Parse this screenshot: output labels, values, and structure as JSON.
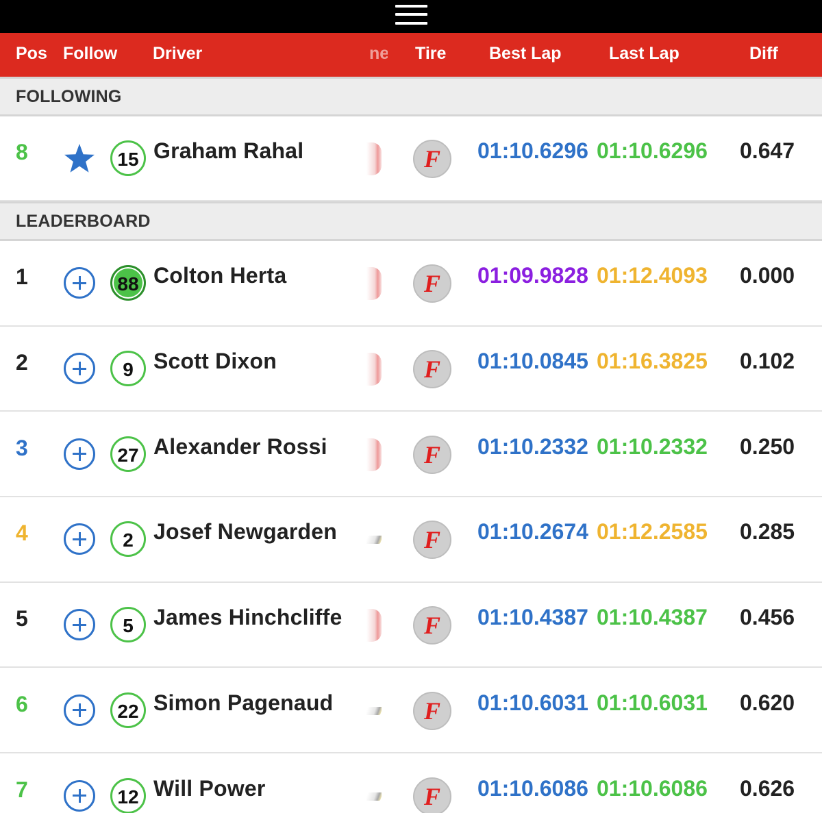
{
  "topbar": {
    "menu_icon": "hamburger-menu-icon"
  },
  "columns": {
    "pos": "Pos",
    "follow": "Follow",
    "driver": "Driver",
    "time_partial": "ne",
    "tire": "Tire",
    "best_lap": "Best Lap",
    "last_lap": "Last Lap",
    "diff": "Diff"
  },
  "sections": {
    "following": "FOLLOWING",
    "leaderboard": "LEADERBOARD"
  },
  "colors": {
    "header_red": "#dc2a1f",
    "link_blue": "#2f72c8",
    "green": "#4cc248",
    "yellow": "#efb430",
    "purple": "#8b1fe0",
    "black": "#222222"
  },
  "following": [
    {
      "pos": "8",
      "pos_color": "#4cc248",
      "follow": "star",
      "car": "15",
      "car_filled": false,
      "driver": "Graham Rahal",
      "time_icon": "red",
      "tire": "F",
      "best": "01:10.6296",
      "best_color": "#2f72c8",
      "last": "01:10.6296",
      "last_color": "#4cc248",
      "diff": "0.647"
    }
  ],
  "leaderboard": [
    {
      "pos": "1",
      "pos_color": "#222222",
      "follow": "plus",
      "car": "88",
      "car_filled": true,
      "driver": "Colton Herta",
      "time_icon": "red",
      "tire": "F",
      "best": "01:09.9828",
      "best_color": "#8b1fe0",
      "last": "01:12.4093",
      "last_color": "#efb430",
      "diff": "0.000"
    },
    {
      "pos": "2",
      "pos_color": "#222222",
      "follow": "plus",
      "car": "9",
      "car_filled": false,
      "driver": "Scott Dixon",
      "time_icon": "red",
      "tire": "F",
      "best": "01:10.0845",
      "best_color": "#2f72c8",
      "last": "01:16.3825",
      "last_color": "#efb430",
      "diff": "0.102"
    },
    {
      "pos": "3",
      "pos_color": "#2f72c8",
      "follow": "plus",
      "car": "27",
      "car_filled": false,
      "driver": "Alexander Rossi",
      "time_icon": "red",
      "tire": "F",
      "best": "01:10.2332",
      "best_color": "#2f72c8",
      "last": "01:10.2332",
      "last_color": "#4cc248",
      "diff": "0.250"
    },
    {
      "pos": "4",
      "pos_color": "#efb430",
      "follow": "plus",
      "car": "2",
      "car_filled": false,
      "driver": "Josef Newgarden",
      "time_icon": "stripe",
      "tire": "F",
      "best": "01:10.2674",
      "best_color": "#2f72c8",
      "last": "01:12.2585",
      "last_color": "#efb430",
      "diff": "0.285"
    },
    {
      "pos": "5",
      "pos_color": "#222222",
      "follow": "plus",
      "car": "5",
      "car_filled": false,
      "driver": "James Hinchcliffe",
      "time_icon": "red",
      "tire": "F",
      "best": "01:10.4387",
      "best_color": "#2f72c8",
      "last": "01:10.4387",
      "last_color": "#4cc248",
      "diff": "0.456"
    },
    {
      "pos": "6",
      "pos_color": "#4cc248",
      "follow": "plus",
      "car": "22",
      "car_filled": false,
      "driver": "Simon Pagenaud",
      "time_icon": "stripe",
      "tire": "F",
      "best": "01:10.6031",
      "best_color": "#2f72c8",
      "last": "01:10.6031",
      "last_color": "#4cc248",
      "diff": "0.620"
    },
    {
      "pos": "7",
      "pos_color": "#4cc248",
      "follow": "plus",
      "car": "12",
      "car_filled": false,
      "driver": "Will Power",
      "time_icon": "stripe",
      "tire": "F",
      "best": "01:10.6086",
      "best_color": "#2f72c8",
      "last": "01:10.6086",
      "last_color": "#4cc248",
      "diff": "0.626"
    }
  ]
}
